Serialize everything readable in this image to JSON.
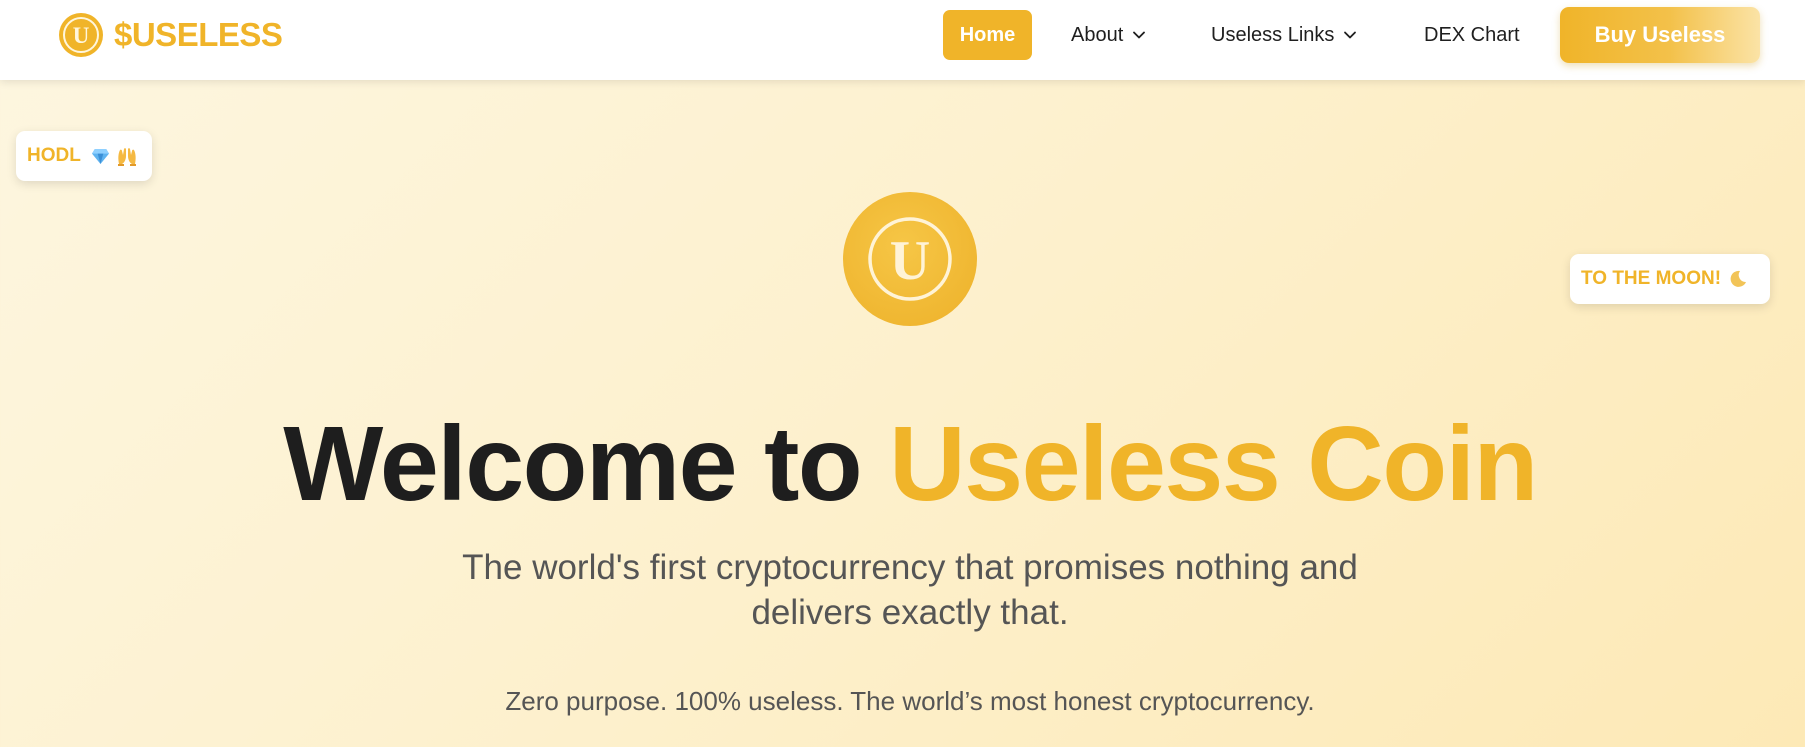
{
  "header": {
    "brand_name": "$USELESS",
    "logo_letter": "U",
    "nav": {
      "home": "Home",
      "about": "About",
      "useless_links": "Useless Links",
      "dex_chart": "DEX Chart"
    },
    "buy_button": "Buy Useless"
  },
  "badges": {
    "hodl": {
      "label": "HODL",
      "icons": [
        "gem-icon",
        "raised-hands-icon"
      ]
    },
    "moon": {
      "label": "TO THE MOON!",
      "icons": [
        "crescent-moon-icon"
      ]
    }
  },
  "hero": {
    "coin_letter": "U",
    "title_prefix": "Welcome to",
    "title_accent": "Useless Coin",
    "subtitle": "The world's first cryptocurrency that promises nothing and delivers exactly that.",
    "tagline": "Zero purpose. 100% useless. The world’s most honest cryptocurrency."
  },
  "colors": {
    "accent": "#f0b429",
    "heading": "#1e1e1e",
    "body_text": "#555555",
    "background_start": "#fdf6e0",
    "background_end": "#fde9b6"
  }
}
